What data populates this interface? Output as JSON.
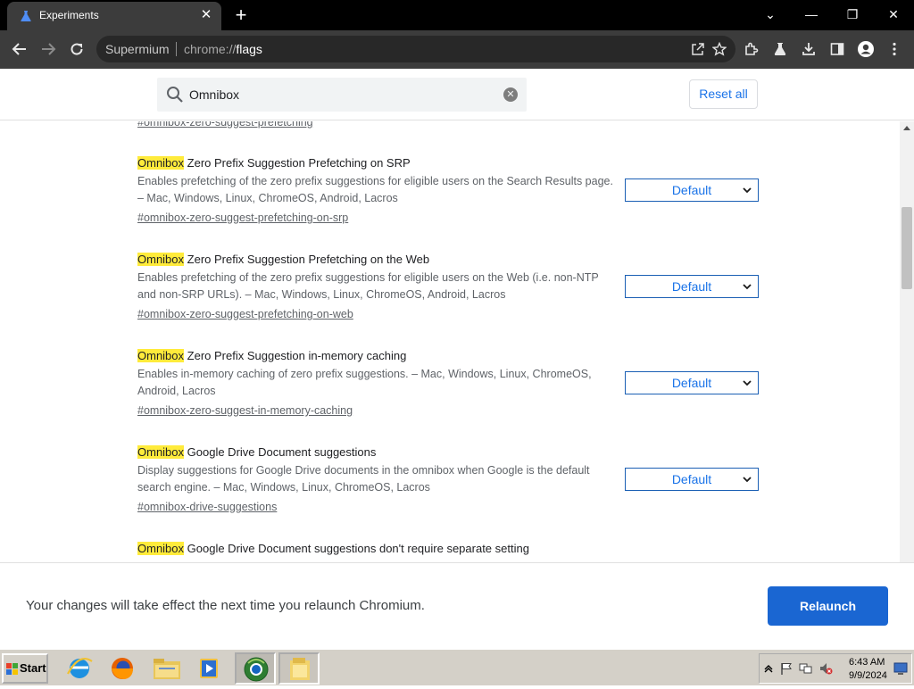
{
  "browser": {
    "tab_title": "Experiments",
    "tab_close": "✕",
    "new_tab": "+",
    "window_controls": {
      "tab_search": "⌄",
      "minimize": "—",
      "restore": "❐",
      "close": "✕"
    },
    "omnibox_origin": "Supermium",
    "url_scheme": "chrome://",
    "url_path": "flags",
    "toolbar_icons": [
      "back-icon",
      "forward-icon",
      "reload-icon",
      "share-icon",
      "star-icon",
      "extensions-icon",
      "labs-icon",
      "download-icon",
      "sidepanel-icon",
      "profile-icon",
      "menu-icon"
    ]
  },
  "header": {
    "search_value": "Omnibox",
    "reset_label": "Reset all"
  },
  "flags": {
    "top_link": "#omnibox-zero-suggest-prefetching",
    "items": [
      {
        "highlight": "Omnibox",
        "title_rest": " Zero Prefix Suggestion Prefetching on SRP",
        "desc": "Enables prefetching of the zero prefix suggestions for eligible users on the Search Results page. – Mac, Windows, Linux, ChromeOS, Android, Lacros",
        "link": "#omnibox-zero-suggest-prefetching-on-srp",
        "select_value": "Default"
      },
      {
        "highlight": "Omnibox",
        "title_rest": " Zero Prefix Suggestion Prefetching on the Web",
        "desc": "Enables prefetching of the zero prefix suggestions for eligible users on the Web (i.e. non-NTP and non-SRP URLs). – Mac, Windows, Linux, ChromeOS, Android, Lacros",
        "link": "#omnibox-zero-suggest-prefetching-on-web",
        "select_value": "Default"
      },
      {
        "highlight": "Omnibox",
        "title_rest": " Zero Prefix Suggestion in-memory caching",
        "desc": "Enables in-memory caching of zero prefix suggestions. – Mac, Windows, Linux, ChromeOS, Android, Lacros",
        "link": "#omnibox-zero-suggest-in-memory-caching",
        "select_value": "Default"
      },
      {
        "highlight": "Omnibox",
        "title_rest": " Google Drive Document suggestions",
        "desc": "Display suggestions for Google Drive documents in the omnibox when Google is the default search engine. – Mac, Windows, Linux, ChromeOS, Lacros",
        "link": "#omnibox-drive-suggestions",
        "select_value": "Default"
      },
      {
        "highlight": "Omnibox",
        "title_rest": " Google Drive Document suggestions don't require separate setting",
        "desc": "",
        "link": "",
        "select_value": ""
      }
    ]
  },
  "relaunch": {
    "message": "Your changes will take effect the next time you relaunch Chromium.",
    "button_label": "Relaunch"
  },
  "taskbar": {
    "start_label": "Start",
    "apps": [
      "ie-icon",
      "firefox-icon",
      "explorer-icon",
      "media-player-icon",
      "chromium-icon",
      "folder-icon"
    ],
    "clock_time": "6:43 AM",
    "clock_date": "9/9/2024"
  },
  "colors": {
    "highlight": "#ffeb3b",
    "accent": "#1a73e8",
    "relaunch_button": "#1a66d2"
  }
}
